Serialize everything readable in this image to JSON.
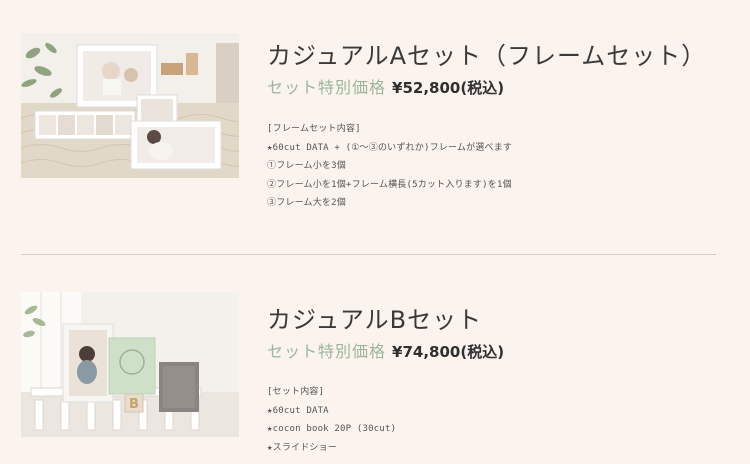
{
  "plans": [
    {
      "title": "カジュアルAセット（フレームセット）",
      "price_label": "セット特別価格",
      "price_value": "¥52,800(税込)",
      "details": [
        "[フレームセット内容]",
        "★60cut DATA + (①〜③のいずれか)フレームが選べます",
        "①フレーム小を3個",
        "②フレーム小を1個+フレーム横長(5カット入ります)を1個",
        "③フレーム大を2個"
      ]
    },
    {
      "title": "カジュアルBセット",
      "price_label": "セット特別価格",
      "price_value": "¥74,800(税込)",
      "details": [
        "[セット内容]",
        "★60cut DATA",
        "★cocon book 20P (30cut)",
        "★スライドショー"
      ]
    }
  ],
  "colors": {
    "background": "#faf3ee",
    "accent_green": "#9bb69a",
    "divider": "#d8ccc2"
  }
}
